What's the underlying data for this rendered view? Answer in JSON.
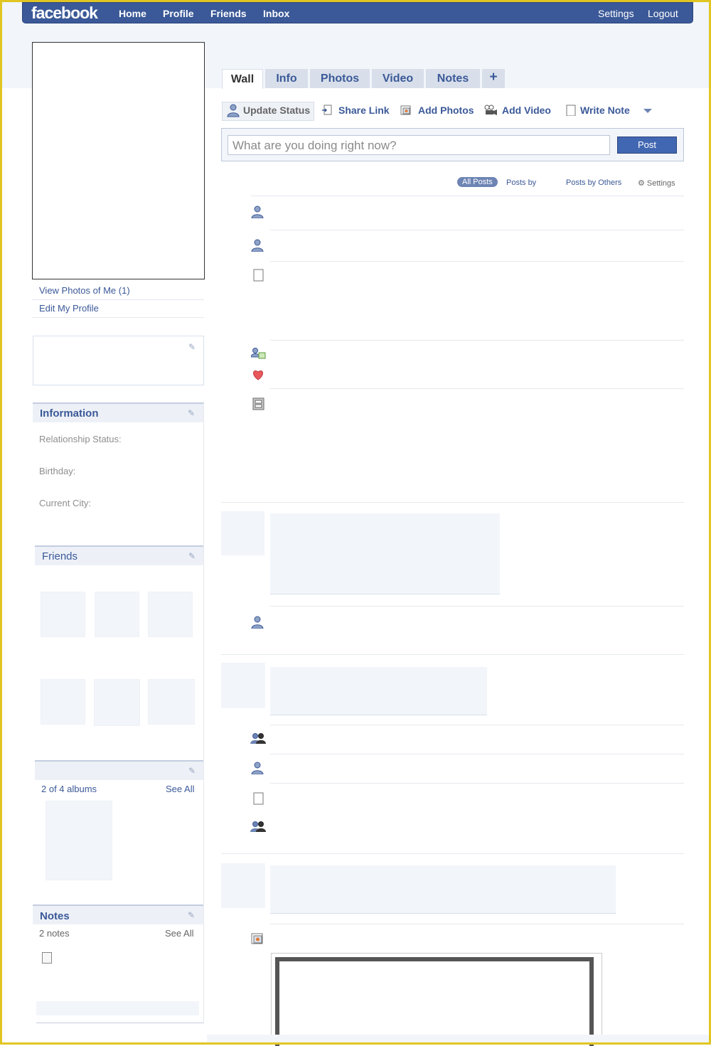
{
  "topbar": {
    "logo": "facebook",
    "nav": [
      "Home",
      "Profile",
      "Friends",
      "Inbox"
    ],
    "right": [
      "Settings",
      "Logout"
    ]
  },
  "left": {
    "view_photos": "View Photos of Me (1)",
    "edit_profile": "Edit My Profile",
    "information": {
      "title": "Information",
      "relationship": "Relationship Status:",
      "birthday": "Birthday:",
      "city": "Current City:"
    },
    "friends_title": "Friends",
    "albums": {
      "count": "2 of 4 albums",
      "see_all": "See All"
    },
    "notes": {
      "title": "Notes",
      "count": "2 notes",
      "see_all": "See All"
    }
  },
  "tabs": [
    "Wall",
    "Info",
    "Photos",
    "Video",
    "Notes",
    "+"
  ],
  "actions": [
    "Update Status",
    "Share Link",
    "Add Photos",
    "Add Video",
    "Write Note"
  ],
  "composer": {
    "placeholder": "What are you doing right now?",
    "post": "Post"
  },
  "filters": {
    "all": "All Posts",
    "by": "Posts by",
    "others": "Posts by Others",
    "settings": "Settings"
  },
  "colors": {
    "brand": "#3b5998",
    "frame": "#e1c623"
  }
}
